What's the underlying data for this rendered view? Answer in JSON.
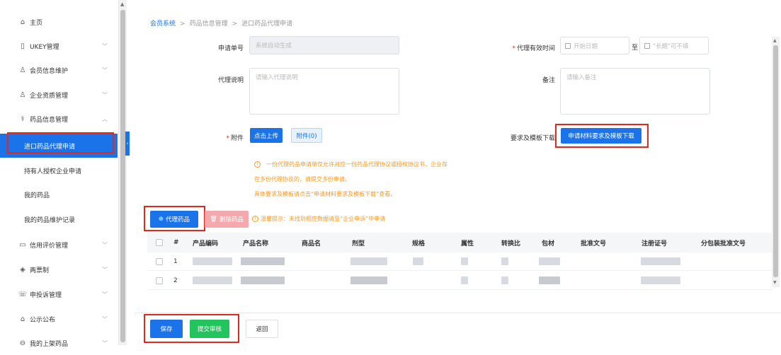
{
  "sidebar": {
    "items": [
      {
        "icon": "home-icon",
        "glyph": "⌂",
        "label": "主页",
        "chevron": ""
      },
      {
        "icon": "ukey-icon",
        "glyph": "▯",
        "label": "UKEY管理",
        "chevron": "﹀"
      },
      {
        "icon": "user-icon",
        "glyph": "♙",
        "label": "会员信息维护",
        "chevron": "﹀"
      },
      {
        "icon": "enterprise-icon",
        "glyph": "♙",
        "label": "企业资质管理",
        "chevron": "﹀"
      },
      {
        "icon": "drug-icon",
        "glyph": "⚕",
        "label": "药品信息管理",
        "chevron": "︿"
      }
    ],
    "sub_items": [
      {
        "label": "进口药品代理申请",
        "active": true
      },
      {
        "label": "持有人授权企业申请",
        "active": false
      },
      {
        "label": "我的药品",
        "active": false
      },
      {
        "label": "我的药品维护记录",
        "active": false
      }
    ],
    "items_after": [
      {
        "icon": "credit-icon",
        "glyph": "▭",
        "label": "信用评价管理",
        "chevron": "﹀"
      },
      {
        "icon": "two-ticket-icon",
        "glyph": "◈",
        "label": "两票制",
        "chevron": "﹀"
      },
      {
        "icon": "complaint-icon",
        "glyph": "☏",
        "label": "申投诉管理",
        "chevron": "﹀"
      },
      {
        "icon": "announcement-icon",
        "glyph": "⌂",
        "label": "公示公布",
        "chevron": "﹀"
      },
      {
        "icon": "my-drug-icon",
        "glyph": "⊖",
        "label": "我的上架药品",
        "chevron": "﹀"
      }
    ]
  },
  "breadcrumb": {
    "items": [
      "会员系统",
      "药品信息管理",
      "进口药品代理申请"
    ],
    "separator": ">"
  },
  "form": {
    "app_no_label": "申请单号",
    "app_no_placeholder": "系统自动生成",
    "validity_label": "代理有效时间",
    "start_date_placeholder": "开始日期",
    "to_label": "至",
    "end_date_placeholder": "\"长期\"可不填",
    "desc_label": "代理说明",
    "desc_placeholder": "请输入代理说明",
    "remark_label": "备注",
    "remark_placeholder": "请输入备注",
    "attach_label": "附件",
    "upload_button": "点击上传",
    "attach_count_button": "附件(0)",
    "template_label": "要求及模板下载",
    "template_button": "申请材料要求及模板下载"
  },
  "notice": {
    "lines": [
      "一份代理药品申请单仅允许对应一份药品代理协议或授权协议书，企业存",
      "在多份代理协议的，请提交多份申请。",
      "具体要求及模板请点击“申请材料要求及模板下载”查看。"
    ]
  },
  "actions": {
    "add_drug": "代理药品",
    "delete_drug": "删除药品",
    "tip": "温馨提示：未找到相应数据请至“企业申诉”中申请"
  },
  "table": {
    "columns": [
      "#",
      "产品编码",
      "产品名称",
      "商品名",
      "剂型",
      "规格",
      "属性",
      "转换比",
      "包材",
      "批准文号",
      "注册证号",
      "分包装批准文号"
    ],
    "rows": [
      {
        "index": "1"
      },
      {
        "index": "2"
      }
    ]
  },
  "footer": {
    "save": "保存",
    "submit": "提交审核",
    "back": "返回"
  },
  "colors": {
    "primary": "#1a73e8",
    "highlight_border": "#e0291e",
    "success": "#21c45d",
    "warning": "#f59a23"
  }
}
